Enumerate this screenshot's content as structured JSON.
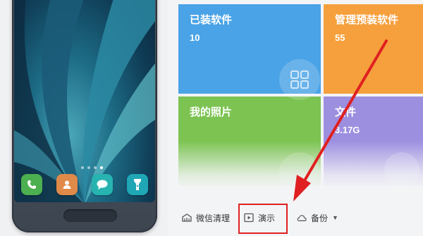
{
  "tiles": [
    {
      "title": "已装软件",
      "count": "10"
    },
    {
      "title": "管理预装软件",
      "count": "55"
    },
    {
      "title": "我的照片",
      "count": ""
    },
    {
      "title": "文件",
      "count": "3.17G"
    }
  ],
  "toolbar": {
    "wechat_clean_label": "微信清理",
    "demo_label": "演示",
    "backup_label": "备份"
  },
  "phone": {
    "dock_icons": [
      "phone-icon",
      "contacts-icon",
      "messages-icon",
      "flashlight-icon"
    ],
    "page_dots": 4,
    "active_dot": 4
  },
  "colors": {
    "blue_tile": "#4aa3e6",
    "orange_tile": "#f5a03d",
    "green_tile": "#7cc352",
    "purple_tile": "#9d8fe0",
    "annotation_red": "#e02020"
  }
}
